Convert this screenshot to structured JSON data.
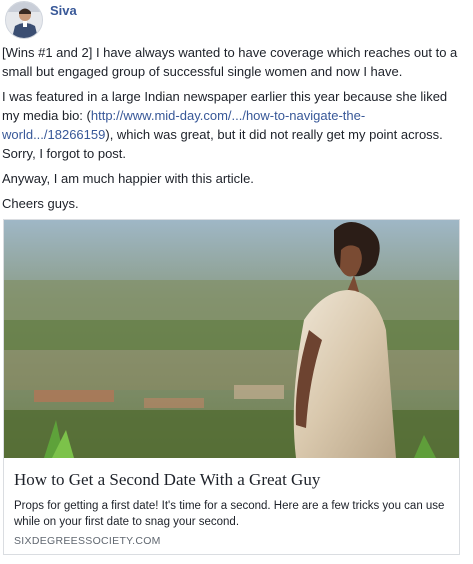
{
  "post": {
    "author": "Siva",
    "paragraphs": {
      "p1": "[Wins #1 and 2] I have always wanted to have coverage which reaches out to a small but engaged group of successful single women and now I have.",
      "p2_before": "I was featured in a large Indian newspaper earlier this year because she liked my media bio: (",
      "p2_link": "http://www.mid-day.com/.../how-to-navigate-the-world.../18266159",
      "p2_after": "), which was great, but it did not really get my point across. Sorry, I forgot to post.",
      "p3": "Anyway, I am much happier with this article.",
      "p4": "Cheers guys."
    },
    "link_preview": {
      "title": "How to Get a Second Date With a Great Guy",
      "description": "Props for getting a first date! It's time for a second. Here are a few tricks you can use while on your first date to snag your second.",
      "domain": "SIXDEGREESSOCIETY.COM"
    }
  }
}
